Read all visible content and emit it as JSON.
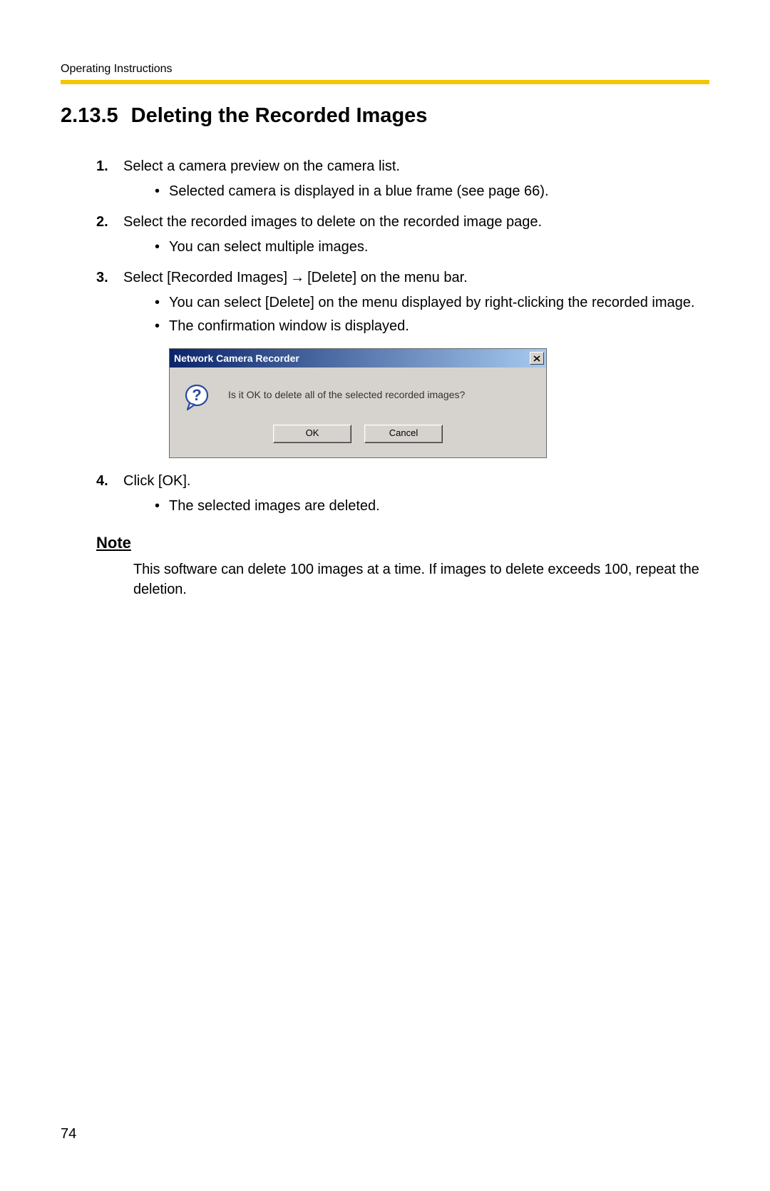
{
  "header": {
    "label": "Operating Instructions"
  },
  "section": {
    "number": "2.13.5",
    "title": "Deleting the Recorded Images"
  },
  "steps": [
    {
      "num": "1.",
      "text": "Select a camera preview on the camera list.",
      "sub": [
        "Selected camera is displayed in a blue frame (see page 66)."
      ]
    },
    {
      "num": "2.",
      "text": "Select the recorded images to delete on the recorded image page.",
      "sub": [
        "You can select multiple images."
      ]
    },
    {
      "num": "3.",
      "text_parts": {
        "a": "Select [Recorded Images]",
        "arrow": "→",
        "b": "[Delete] on the menu bar."
      },
      "sub": [
        "You can select [Delete] on the menu displayed by right-clicking the recorded image.",
        "The confirmation window is displayed."
      ]
    },
    {
      "num": "4.",
      "text": "Click [OK].",
      "sub": [
        "The selected images are deleted."
      ]
    }
  ],
  "dialog": {
    "title": "Network Camera Recorder",
    "close": "×",
    "message": "Is it OK to delete all of the selected recorded images?",
    "ok": "OK",
    "cancel": "Cancel"
  },
  "note": {
    "heading": "Note",
    "text": "This software can delete 100 images at a time. If images to delete exceeds 100, repeat the deletion."
  },
  "page_number": "74"
}
